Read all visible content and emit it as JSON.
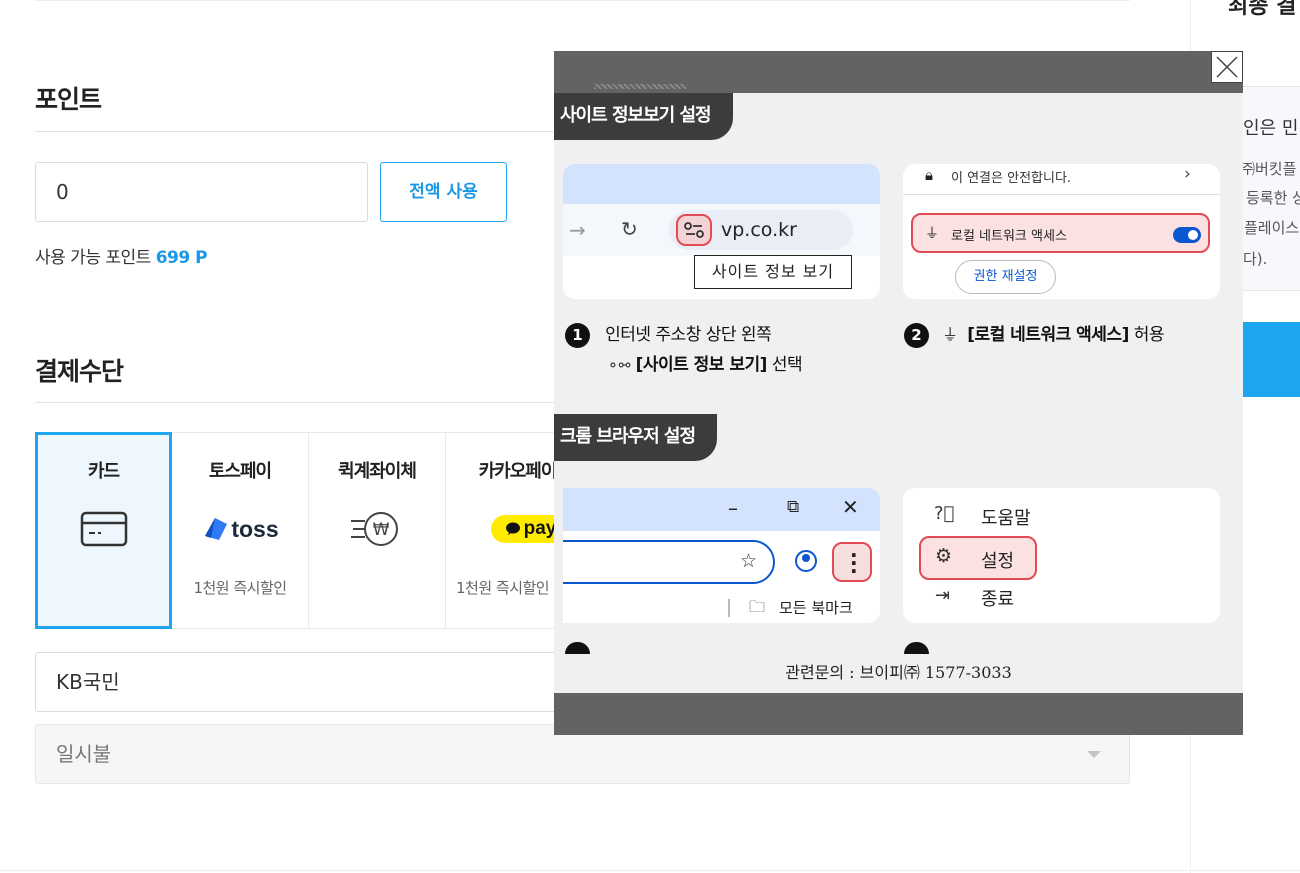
{
  "point": {
    "title": "포인트",
    "input_value": "0",
    "use_all_label": "전액 사용",
    "available_label": "사용 가능 포인트",
    "available_value": "699 P"
  },
  "payment": {
    "title": "결제수단",
    "methods": [
      {
        "label": "카드",
        "icon": "credit-card-icon",
        "sub": ""
      },
      {
        "label": "토스페이",
        "icon": "toss-logo",
        "sub": "1천원 즉시할인",
        "logo_text": "toss"
      },
      {
        "label": "퀵계좌이체",
        "icon": "fast-won-transfer-icon",
        "sub": ""
      },
      {
        "label": "카카오페이",
        "icon": "kakaopay-logo",
        "sub": "1천원 즉시할인",
        "logo_text": "pay"
      }
    ],
    "bank_select": "KB국민",
    "installment_select": "일시불"
  },
  "right_col": {
    "lines": [
      "인은 민",
      "㈜버킷플",
      "등록한 상",
      "플레이스",
      "다)."
    ]
  },
  "popup": {
    "section1": {
      "tab": "사이트 정보보기 설정",
      "shot1": {
        "url": "vp.co.kr",
        "tooltip": "사이트 정보 보기"
      },
      "shot2": {
        "secure_text": "이 연결은 안전합니다.",
        "lna_label": "로컬 네트워크 액세스",
        "reset_label": "권한 재설정"
      },
      "step1_num": "1",
      "step1_line1": "인터넷 주소창 상단 왼쪽",
      "step1_bold": "[사이트 정보 보기]",
      "step1_tail": " 선택",
      "step2_num": "2",
      "step2_bold": "[로컬 네트워크 액세스]",
      "step2_tail": " 허용"
    },
    "section2": {
      "tab": "크롬 브라우저 설정",
      "shot3": {
        "bookmark_label": "모든 북마크"
      },
      "menu": {
        "help": "도움말",
        "settings": "설정",
        "exit": "종료"
      }
    },
    "contact": "관련문의 : 브이피㈜ 1577-3033"
  },
  "colors": {
    "accent": "#1da5ef",
    "popup_frame": "#636363",
    "highlight_red": "#e34b54"
  }
}
